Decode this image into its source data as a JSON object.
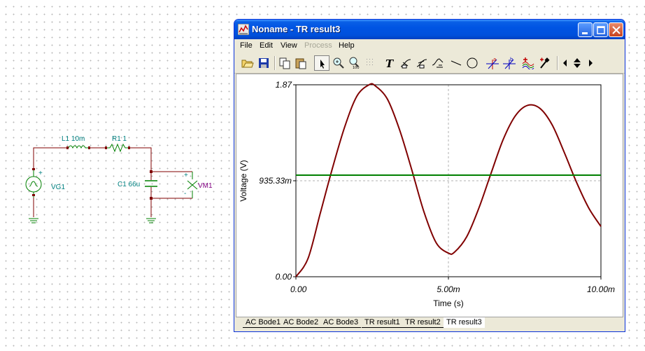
{
  "schematic": {
    "source_label": "VG1",
    "inductor_label": "L1 10m",
    "resistor_label": "R1 1",
    "capacitor_label": "C1 66u",
    "meter_label": "VM1",
    "plus_sign": "+",
    "minus_sign": "-"
  },
  "window": {
    "title": "Noname - TR result3",
    "menu": [
      "File",
      "Edit",
      "View",
      "Process",
      "Help"
    ],
    "toolbar_icons": [
      "open-icon",
      "save-icon",
      "copy-icon",
      "paste-icon",
      "arrow-icon",
      "zoom-in-icon",
      "zoom-100-icon",
      "grid-icon",
      "text-icon",
      "curve-label-icon",
      "curve-label2-icon",
      "curve-edit-icon",
      "line-icon",
      "circle-icon",
      "cursor-a-icon",
      "cursor-b-icon",
      "add-curve-icon",
      "marker-icon",
      "nav-left-icon",
      "nav-updown-icon",
      "nav-right-icon"
    ]
  },
  "chart_data": {
    "type": "line",
    "xlabel": "Time (s)",
    "ylabel": "Voltage (V)",
    "x_ticks": [
      "0.00",
      "5.00m",
      "10.00m"
    ],
    "y_ticks": [
      "0.00",
      "935.33m",
      "1.87"
    ],
    "xlim": [
      0,
      0.01
    ],
    "ylim": [
      0,
      1.87
    ],
    "grid": true,
    "series": [
      {
        "color": "#800000",
        "x": [
          0,
          0.0004,
          0.0008,
          0.0012,
          0.0016,
          0.002,
          0.0024,
          0.0026,
          0.003,
          0.0034,
          0.0038,
          0.0042,
          0.0046,
          0.005,
          0.0052,
          0.0056,
          0.006,
          0.0064,
          0.0068,
          0.0072,
          0.0076,
          0.008,
          0.0084,
          0.0088,
          0.0092,
          0.0096,
          0.01
        ],
        "values": [
          0,
          0.18,
          0.62,
          1.06,
          1.46,
          1.76,
          1.87,
          1.86,
          1.73,
          1.43,
          1.04,
          0.63,
          0.33,
          0.23,
          0.24,
          0.39,
          0.67,
          1.01,
          1.34,
          1.57,
          1.67,
          1.64,
          1.48,
          1.21,
          0.92,
          0.67,
          0.49
        ]
      },
      {
        "color": "#008000",
        "x": [
          0,
          0.01
        ],
        "values": [
          0.99,
          0.99
        ]
      }
    ]
  },
  "tabs": [
    "AC Bode1",
    "AC Bode2",
    "AC Bode3",
    "TR result1",
    "TR result2",
    "TR result3"
  ],
  "active_tab": "TR result3"
}
